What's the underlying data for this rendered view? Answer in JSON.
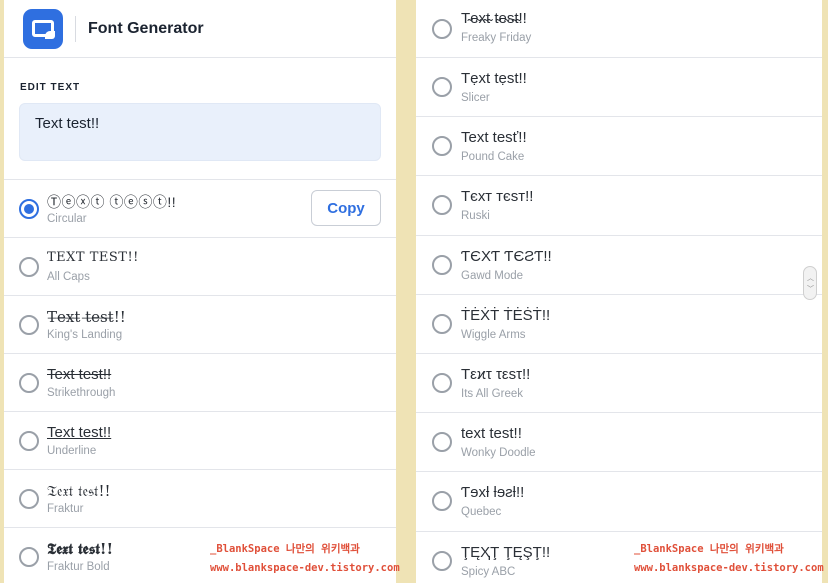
{
  "header": {
    "title": "Font Generator",
    "logo_icon": "font-generator-logo-icon"
  },
  "edit": {
    "label": "EDIT TEXT",
    "value": "Text test!!"
  },
  "copy_label": "Copy",
  "accent_color": "#2f6fe0",
  "left_fonts": [
    {
      "sample": "Ⓣⓔⓧⓣ ⓣⓔⓢⓣ!!",
      "name": "Circular",
      "selected": true
    },
    {
      "sample": "TEXT TEST!!",
      "name": "All Caps"
    },
    {
      "sample": "T̶e̶x̶t̶ t̶e̶s̶t̶!!",
      "name": "King's Landing"
    },
    {
      "sample": "Text test!!",
      "name": "Strikethrough"
    },
    {
      "sample": "Text test!!",
      "name": "Underline"
    },
    {
      "sample": "𝔗𝔢𝔵𝔱 𝔱𝔢𝔰𝔱!!",
      "name": "Fraktur"
    },
    {
      "sample": "𝕿𝖊𝖝𝖙 𝖙𝖊𝖘𝖙!!",
      "name": "Fraktur Bold"
    }
  ],
  "right_fonts": [
    {
      "sample": "T̴e̴x̴t̴ t̴e̴s̴t̴!!",
      "name": "Freaky Friday"
    },
    {
      "sample": "Tẹxt tẹst!!",
      "name": "Slicer"
    },
    {
      "sample": "Text tesť!!",
      "name": "Pound Cake"
    },
    {
      "sample": "Тєхт тєѕт!!",
      "name": "Ruski"
    },
    {
      "sample": "ƬЄXƬ ƬЄƧƬ!!",
      "name": "Gawd Mode"
    },
    {
      "sample": "ṪĖẊṪ ṪĖṠṪ!!",
      "name": "Wiggle Arms"
    },
    {
      "sample": "Tεϰτ τεsτ!!",
      "name": "Its All Greek"
    },
    {
      "sample": "text test!!",
      "name": "Wonky Doodle"
    },
    {
      "sample": "Ƭɘxƚ ƚɘƨƚ!!",
      "name": "Quebec"
    },
    {
      "sample": "ŢĘҲŢ ŢĘŞŢ!!",
      "name": "Spicy ABC"
    }
  ],
  "watermark": {
    "line1": "_BlankSpace 나만의 위키백과",
    "line2": "www.blankspace-dev.tistory.com"
  }
}
